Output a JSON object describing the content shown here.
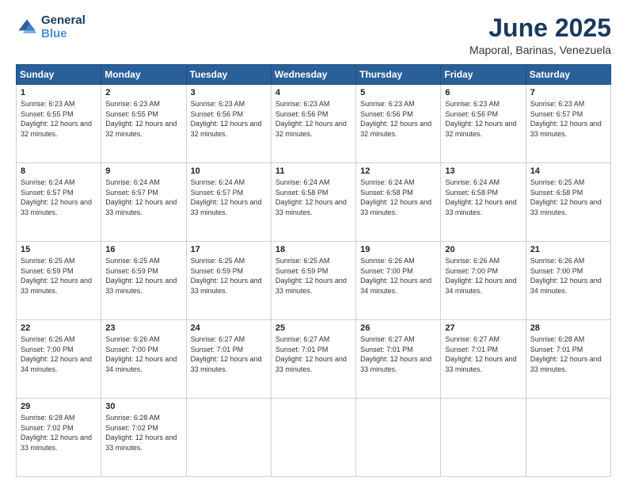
{
  "header": {
    "logo_line1": "General",
    "logo_line2": "Blue",
    "title": "June 2025",
    "subtitle": "Maporal, Barinas, Venezuela"
  },
  "days_of_week": [
    "Sunday",
    "Monday",
    "Tuesday",
    "Wednesday",
    "Thursday",
    "Friday",
    "Saturday"
  ],
  "weeks": [
    [
      {
        "num": "1",
        "sunrise": "6:23 AM",
        "sunset": "6:55 PM",
        "daylight": "12 hours and 32 minutes."
      },
      {
        "num": "2",
        "sunrise": "6:23 AM",
        "sunset": "6:55 PM",
        "daylight": "12 hours and 32 minutes."
      },
      {
        "num": "3",
        "sunrise": "6:23 AM",
        "sunset": "6:56 PM",
        "daylight": "12 hours and 32 minutes."
      },
      {
        "num": "4",
        "sunrise": "6:23 AM",
        "sunset": "6:56 PM",
        "daylight": "12 hours and 32 minutes."
      },
      {
        "num": "5",
        "sunrise": "6:23 AM",
        "sunset": "6:56 PM",
        "daylight": "12 hours and 32 minutes."
      },
      {
        "num": "6",
        "sunrise": "6:23 AM",
        "sunset": "6:56 PM",
        "daylight": "12 hours and 32 minutes."
      },
      {
        "num": "7",
        "sunrise": "6:23 AM",
        "sunset": "6:57 PM",
        "daylight": "12 hours and 33 minutes."
      }
    ],
    [
      {
        "num": "8",
        "sunrise": "6:24 AM",
        "sunset": "6:57 PM",
        "daylight": "12 hours and 33 minutes."
      },
      {
        "num": "9",
        "sunrise": "6:24 AM",
        "sunset": "6:57 PM",
        "daylight": "12 hours and 33 minutes."
      },
      {
        "num": "10",
        "sunrise": "6:24 AM",
        "sunset": "6:57 PM",
        "daylight": "12 hours and 33 minutes."
      },
      {
        "num": "11",
        "sunrise": "6:24 AM",
        "sunset": "6:58 PM",
        "daylight": "12 hours and 33 minutes."
      },
      {
        "num": "12",
        "sunrise": "6:24 AM",
        "sunset": "6:58 PM",
        "daylight": "12 hours and 33 minutes."
      },
      {
        "num": "13",
        "sunrise": "6:24 AM",
        "sunset": "6:58 PM",
        "daylight": "12 hours and 33 minutes."
      },
      {
        "num": "14",
        "sunrise": "6:25 AM",
        "sunset": "6:58 PM",
        "daylight": "12 hours and 33 minutes."
      }
    ],
    [
      {
        "num": "15",
        "sunrise": "6:25 AM",
        "sunset": "6:59 PM",
        "daylight": "12 hours and 33 minutes."
      },
      {
        "num": "16",
        "sunrise": "6:25 AM",
        "sunset": "6:59 PM",
        "daylight": "12 hours and 33 minutes."
      },
      {
        "num": "17",
        "sunrise": "6:25 AM",
        "sunset": "6:59 PM",
        "daylight": "12 hours and 33 minutes."
      },
      {
        "num": "18",
        "sunrise": "6:25 AM",
        "sunset": "6:59 PM",
        "daylight": "12 hours and 33 minutes."
      },
      {
        "num": "19",
        "sunrise": "6:26 AM",
        "sunset": "7:00 PM",
        "daylight": "12 hours and 34 minutes."
      },
      {
        "num": "20",
        "sunrise": "6:26 AM",
        "sunset": "7:00 PM",
        "daylight": "12 hours and 34 minutes."
      },
      {
        "num": "21",
        "sunrise": "6:26 AM",
        "sunset": "7:00 PM",
        "daylight": "12 hours and 34 minutes."
      }
    ],
    [
      {
        "num": "22",
        "sunrise": "6:26 AM",
        "sunset": "7:00 PM",
        "daylight": "12 hours and 34 minutes."
      },
      {
        "num": "23",
        "sunrise": "6:26 AM",
        "sunset": "7:00 PM",
        "daylight": "12 hours and 34 minutes."
      },
      {
        "num": "24",
        "sunrise": "6:27 AM",
        "sunset": "7:01 PM",
        "daylight": "12 hours and 33 minutes."
      },
      {
        "num": "25",
        "sunrise": "6:27 AM",
        "sunset": "7:01 PM",
        "daylight": "12 hours and 33 minutes."
      },
      {
        "num": "26",
        "sunrise": "6:27 AM",
        "sunset": "7:01 PM",
        "daylight": "12 hours and 33 minutes."
      },
      {
        "num": "27",
        "sunrise": "6:27 AM",
        "sunset": "7:01 PM",
        "daylight": "12 hours and 33 minutes."
      },
      {
        "num": "28",
        "sunrise": "6:28 AM",
        "sunset": "7:01 PM",
        "daylight": "12 hours and 33 minutes."
      }
    ],
    [
      {
        "num": "29",
        "sunrise": "6:28 AM",
        "sunset": "7:02 PM",
        "daylight": "12 hours and 33 minutes."
      },
      {
        "num": "30",
        "sunrise": "6:28 AM",
        "sunset": "7:02 PM",
        "daylight": "12 hours and 33 minutes."
      },
      null,
      null,
      null,
      null,
      null
    ]
  ],
  "labels": {
    "sunrise": "Sunrise:",
    "sunset": "Sunset:",
    "daylight": "Daylight:"
  }
}
